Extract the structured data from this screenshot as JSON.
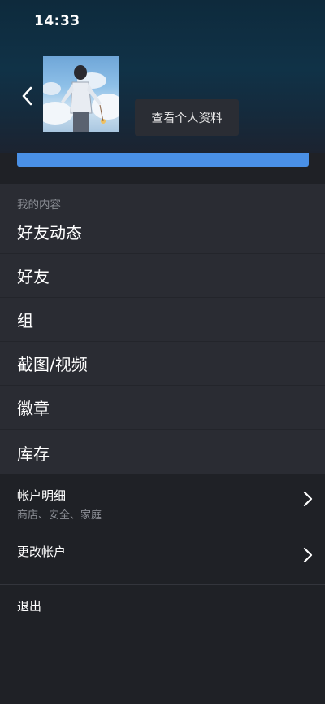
{
  "status_bar": {
    "time": "14:33"
  },
  "header": {
    "view_profile_label": "查看个人资料"
  },
  "content": {
    "section_title": "我的内容",
    "items": [
      {
        "label": "好友动态"
      },
      {
        "label": "好友"
      },
      {
        "label": "组"
      },
      {
        "label": "截图/视频"
      },
      {
        "label": "徽章"
      },
      {
        "label": "库存"
      }
    ]
  },
  "account": {
    "details_title": "帐户明细",
    "details_subtitle": "商店、安全、家庭",
    "change_title": "更改帐户",
    "logout_label": "退出"
  },
  "colors": {
    "accent_blue": "#4a90e6",
    "panel_bg": "#2a2c33",
    "page_bg": "#1f2126"
  },
  "icons": {
    "back": "chevron-left-icon",
    "arrow": "chevron-right-icon"
  }
}
